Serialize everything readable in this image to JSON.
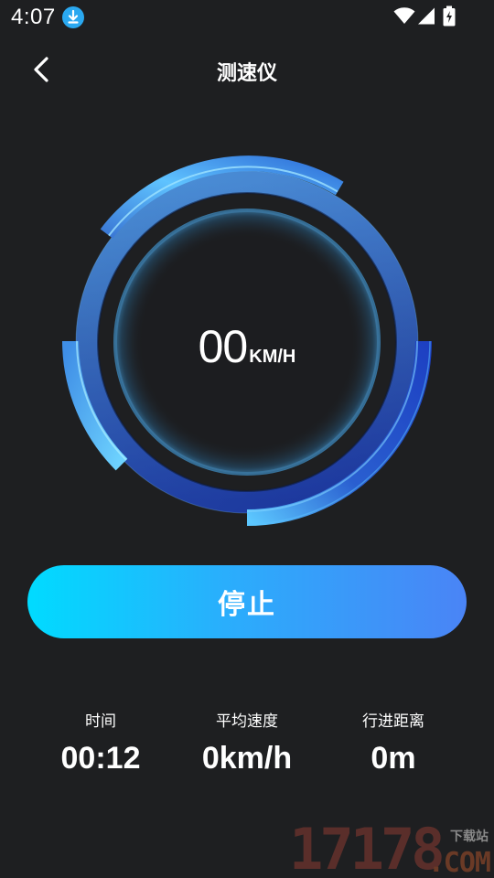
{
  "status_bar": {
    "time": "4:07",
    "icons": [
      "download-icon",
      "wifi-icon",
      "signal-icon",
      "battery-icon"
    ]
  },
  "header": {
    "back_icon": "chevron-left-icon",
    "title": "测速仪"
  },
  "gauge": {
    "speed_value": "00",
    "speed_unit": "KM/H",
    "colors": {
      "arc_light": "#57c9ff",
      "arc_dark": "#1e3fae",
      "ring_top": "#4f9ee0",
      "ring_bottom": "#1d3fa8",
      "inner_glow": "#3a7fb0"
    }
  },
  "stop_button": {
    "label": "停止",
    "gradient_start": "#00dbff",
    "gradient_end": "#4a84f6"
  },
  "stats": [
    {
      "label": "时间",
      "value": "00:12"
    },
    {
      "label": "平均速度",
      "value": "0km/h"
    },
    {
      "label": "行进距离",
      "value": "0m"
    }
  ],
  "watermark": {
    "digits": "17178",
    "tagline": "下载站",
    "domain": ".COM"
  }
}
